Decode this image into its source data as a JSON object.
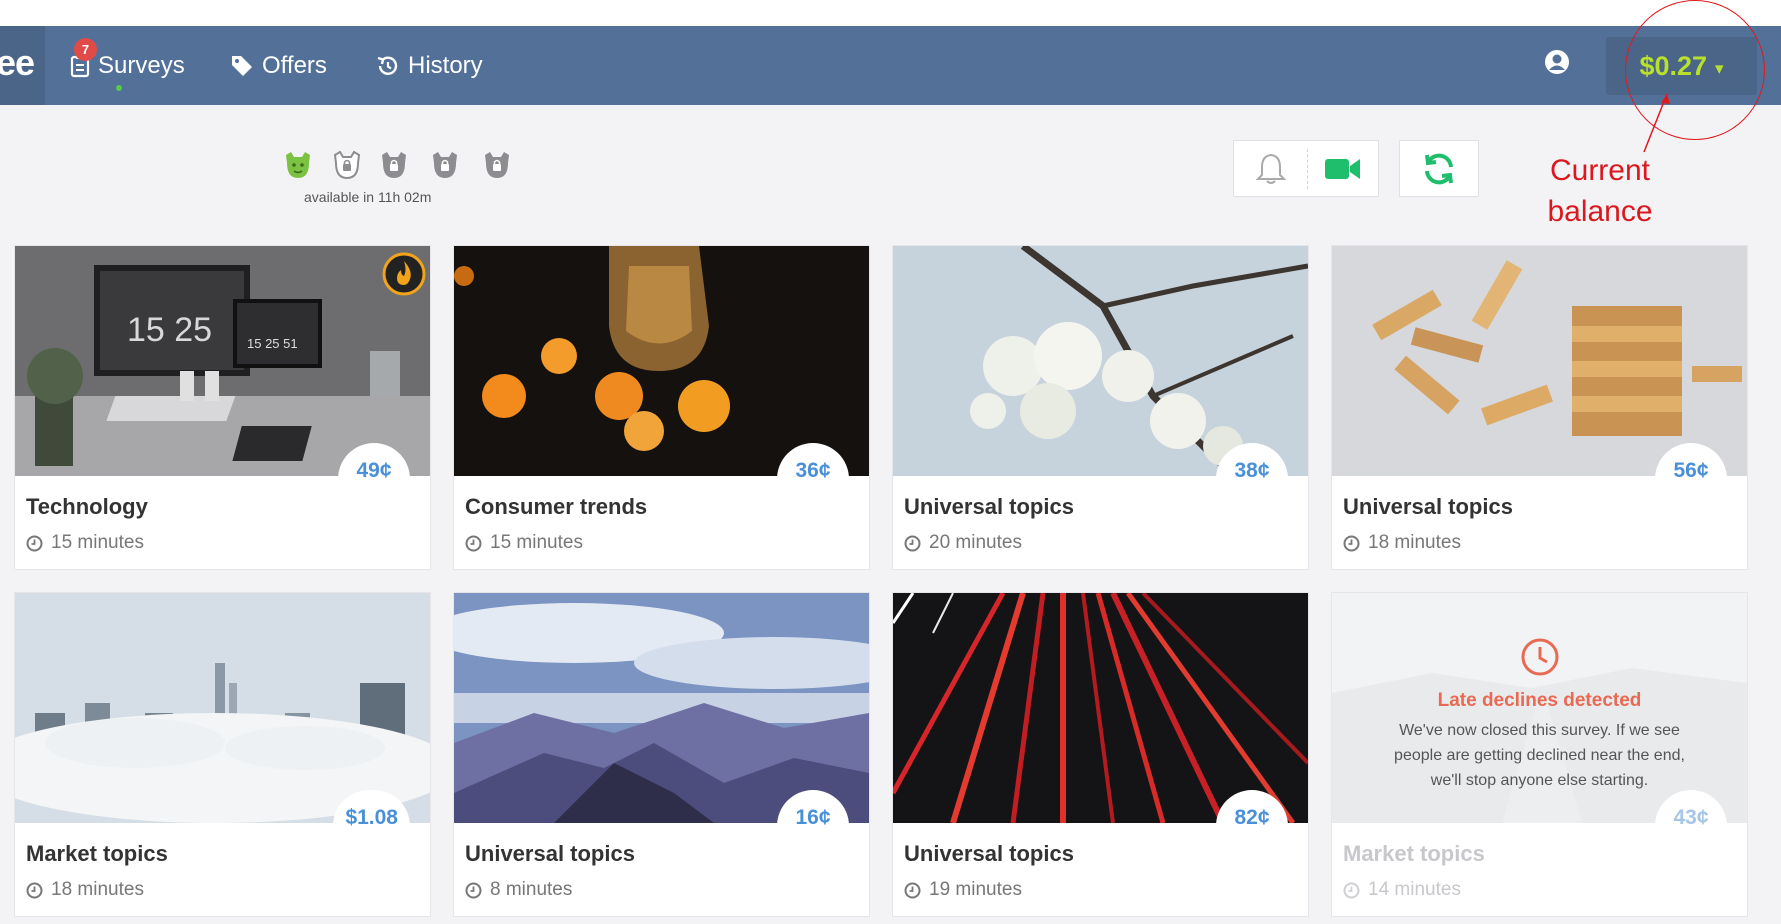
{
  "brand": {
    "logo_text": "ee"
  },
  "nav": {
    "surveys_label": "Surveys",
    "surveys_badge": "7",
    "offers_label": "Offers",
    "history_label": "History"
  },
  "account": {
    "balance": "$0.27",
    "balance_caret": "▾"
  },
  "levels": {
    "caption": "available in 11h 02m",
    "icons": [
      "level-unlocked-green",
      "level-locked-outline",
      "level-locked",
      "level-locked",
      "level-locked"
    ]
  },
  "annotation": {
    "text": "Current balance",
    "color": "#d9191f"
  },
  "surveys": [
    {
      "title": "Technology",
      "time": "15 minutes",
      "reward": "49¢",
      "hot": true
    },
    {
      "title": "Consumer trends",
      "time": "15 minutes",
      "reward": "36¢"
    },
    {
      "title": "Universal topics",
      "time": "20 minutes",
      "reward": "38¢"
    },
    {
      "title": "Universal topics",
      "time": "18 minutes",
      "reward": "56¢"
    },
    {
      "title": "Market topics",
      "time": "18 minutes",
      "reward": "$1.08"
    },
    {
      "title": "Universal topics",
      "time": "8 minutes",
      "reward": "16¢"
    },
    {
      "title": "Universal topics",
      "time": "19 minutes",
      "reward": "82¢"
    },
    {
      "title": "Market topics",
      "time": "14 minutes",
      "reward": "43¢",
      "disabled": true,
      "notice_title": "Late declines detected",
      "notice_text": "We've now closed this survey. If we see people are getting declined near the end, we'll stop anyone else starting."
    }
  ],
  "colors": {
    "topbar": "#537099",
    "balance": "#b9e02a",
    "reward": "#4a90d9",
    "accent_green": "#1fbe6c",
    "notice": "#e96a52"
  }
}
